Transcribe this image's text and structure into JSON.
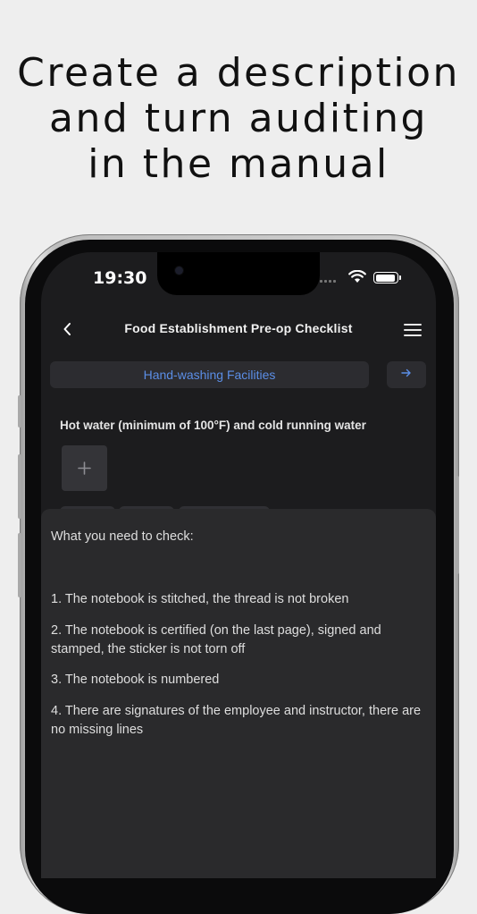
{
  "headline": {
    "lines": [
      "Create a description",
      "and turn auditing",
      "in the manual"
    ]
  },
  "status_bar": {
    "time": "19:30"
  },
  "nav": {
    "title": "Food Establishment Pre-op Checklist"
  },
  "section": {
    "label": "Hand-washing Facilities",
    "next_icon": "arrow-right-icon"
  },
  "question": {
    "text": "Hot water (minimum of 100°F) and cold running water",
    "add_icon": "plus-icon"
  },
  "sheet": {
    "heading": "What you need to check:",
    "items": [
      "1. The notebook is stitched, the thread is not broken",
      "2. The notebook is certified (on the last page), signed and stamped, the sticker is not torn off",
      "3. The notebook is numbered",
      "4. There are signatures of the employee and instructor, there are no missing lines"
    ]
  },
  "colors": {
    "accent": "#5b8ee6",
    "screen_bg": "#1c1c1e",
    "sheet_bg": "#2a2a2c",
    "page_bg": "#eeeeee"
  }
}
